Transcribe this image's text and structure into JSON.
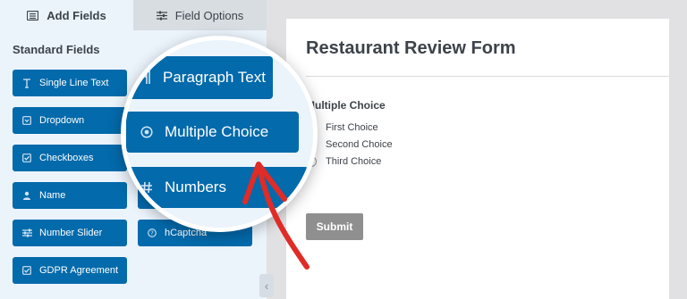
{
  "tabs": [
    {
      "label": "Add Fields",
      "icon": "list-icon",
      "active": true
    },
    {
      "label": "Field Options",
      "icon": "sliders-icon",
      "active": false
    }
  ],
  "sidebar": {
    "section_title": "Standard Fields",
    "fields": [
      {
        "label": "Single Line Text",
        "icon": "text-cursor-icon"
      },
      {
        "label": "Dropdown",
        "icon": "dropdown-icon"
      },
      {
        "label": "Checkboxes",
        "icon": "checkbox-icon"
      },
      {
        "label": "Name",
        "icon": "user-icon"
      },
      {
        "label": "Number Slider",
        "icon": "sliders-icon"
      },
      {
        "label": "hCaptcha",
        "icon": "question-circle-icon"
      },
      {
        "label": "GDPR Agreement",
        "icon": "checkbox-icon"
      }
    ],
    "collapse_icon": "chevron-left-icon"
  },
  "magnifier": {
    "items": [
      {
        "label": "Paragraph Text",
        "icon": "paragraph-icon"
      },
      {
        "label": "Multiple Choice",
        "icon": "radio-dot-icon"
      },
      {
        "label": "Numbers",
        "icon": "hash-icon"
      }
    ]
  },
  "form": {
    "title": "Restaurant Review Form",
    "field_label": "Multiple Choice",
    "choices": [
      "First Choice",
      "Second Choice",
      "Third Choice"
    ],
    "submit_label": "Submit"
  },
  "colors": {
    "button_blue": "#036aab",
    "panel_bg": "#ebf3fb",
    "arrow_red": "#e02b27",
    "submit_gray": "#8f8f8f"
  }
}
